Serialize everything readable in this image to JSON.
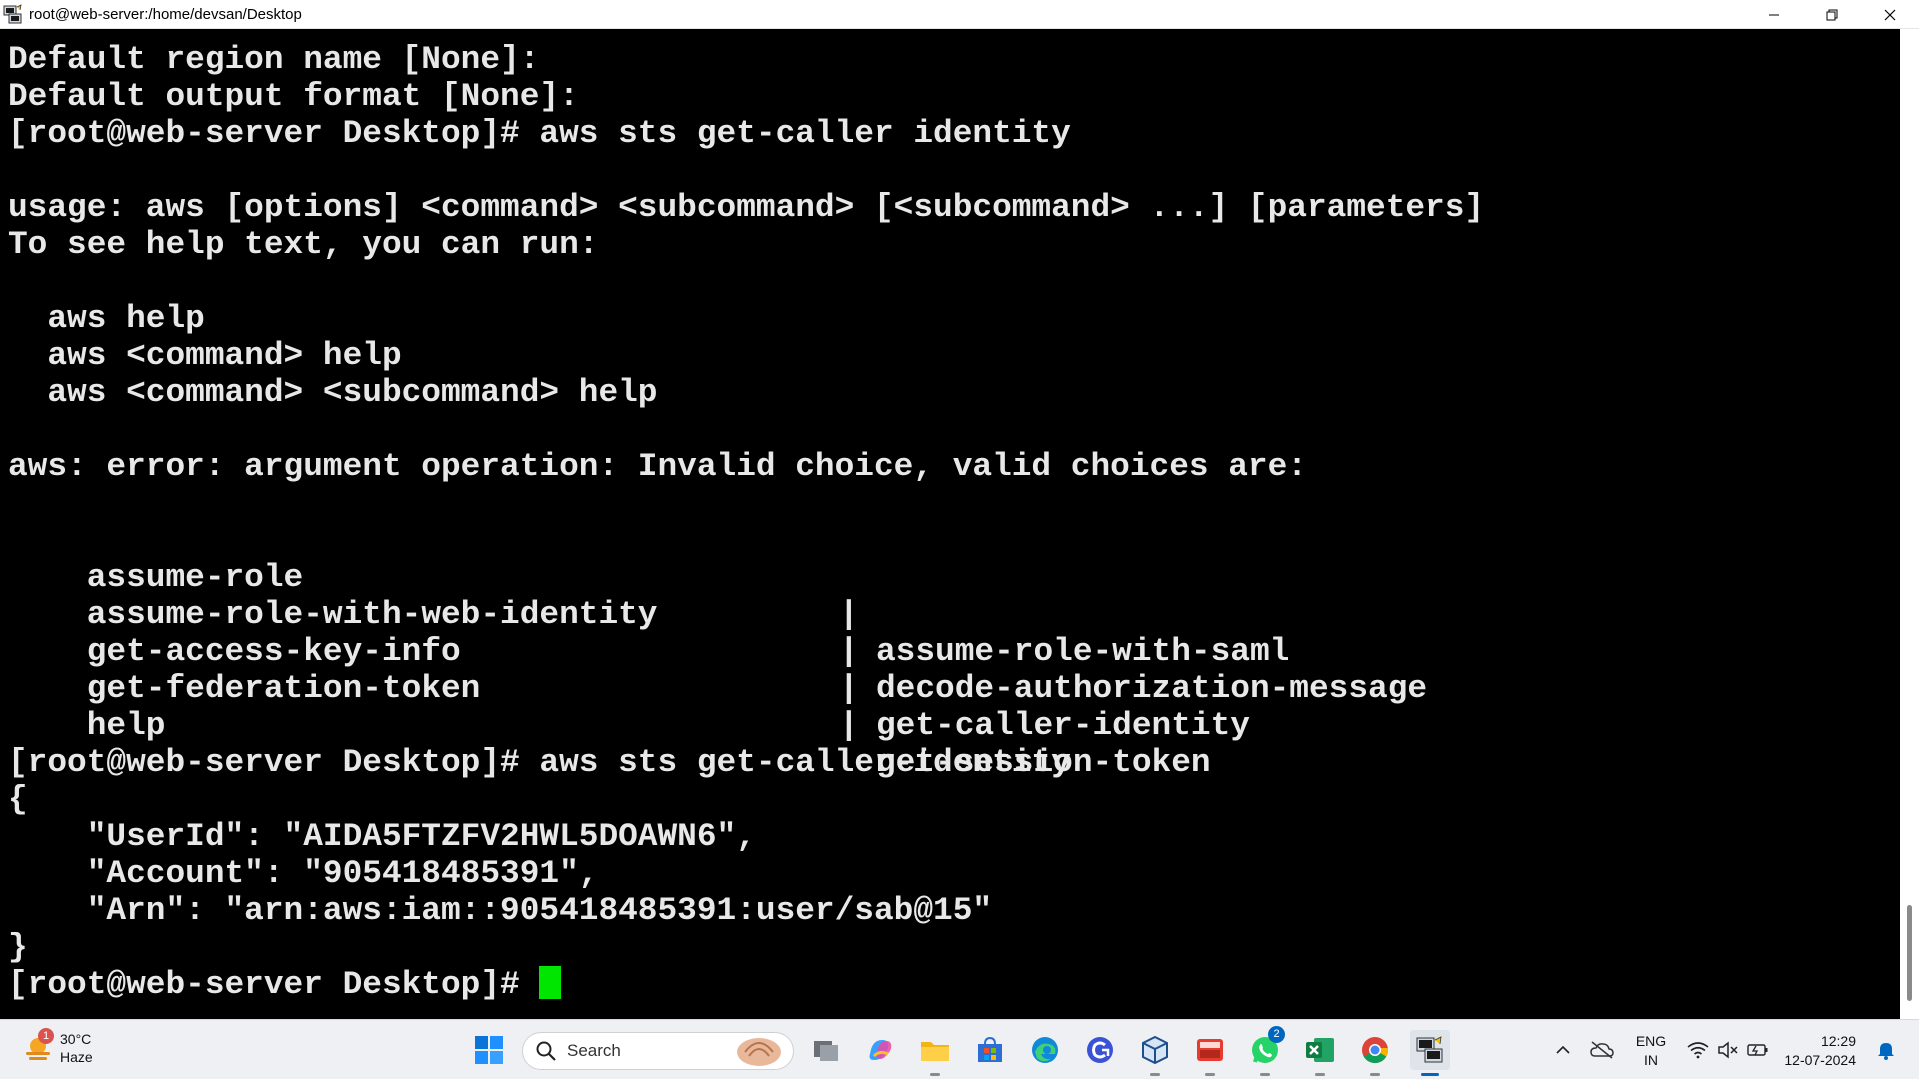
{
  "window": {
    "title": "root@web-server:/home/devsan/Desktop",
    "controls": [
      "minimize-icon",
      "restore-icon",
      "close-icon"
    ]
  },
  "terminal": {
    "lines": [
      "Default region name [None]:",
      "Default output format [None]:",
      "[root@web-server Desktop]# aws sts get-caller identity",
      "",
      "usage: aws [options] <command> <subcommand> [<subcommand> ...] [parameters]",
      "To see help text, you can run:",
      "",
      "  aws help",
      "  aws <command> help",
      "  aws <command> <subcommand> help",
      "",
      "aws: error: argument operation: Invalid choice, valid choices are:",
      ""
    ],
    "choices": [
      {
        "left": "assume-role",
        "bar": "|",
        "right": "assume-role-with-saml"
      },
      {
        "left": "assume-role-with-web-identity",
        "bar": "|",
        "right": "decode-authorization-message"
      },
      {
        "left": "get-access-key-info",
        "bar": "|",
        "right": "get-caller-identity"
      },
      {
        "left": "get-federation-token",
        "bar": "|",
        "right": "get-session-token"
      },
      {
        "left": "help",
        "bar": "",
        "right": ""
      }
    ],
    "lines_after": [
      "",
      "[root@web-server Desktop]# aws sts get-caller-identity",
      "{",
      "    \"UserId\": \"AIDA5FTZFV2HWL5DOAWN6\",",
      "    \"Account\": \"905418485391\",",
      "    \"Arn\": \"arn:aws:iam::905418485391:user/sab@15\"",
      "}"
    ],
    "prompt": "[root@web-server Desktop]# ",
    "cursor_color": "#00e600"
  },
  "taskbar": {
    "weather": {
      "temp": "30°C",
      "condition": "Haze",
      "badge": "1"
    },
    "search_placeholder": "Search",
    "apps": [
      {
        "name": "start-icon"
      },
      {
        "name": "search-box"
      },
      {
        "name": "task-view-icon"
      },
      {
        "name": "copilot-icon"
      },
      {
        "name": "file-explorer-icon"
      },
      {
        "name": "microsoft-store-icon"
      },
      {
        "name": "edge-icon"
      },
      {
        "name": "app-c-icon"
      },
      {
        "name": "virtualbox-icon"
      },
      {
        "name": "app-red-icon"
      },
      {
        "name": "whatsapp-icon",
        "badge": "2"
      },
      {
        "name": "excel-icon"
      },
      {
        "name": "chrome-icon"
      },
      {
        "name": "putty-icon"
      }
    ],
    "tray": {
      "lang_line1": "ENG",
      "lang_line2": "IN",
      "time": "12:29",
      "date": "12-07-2024"
    }
  }
}
